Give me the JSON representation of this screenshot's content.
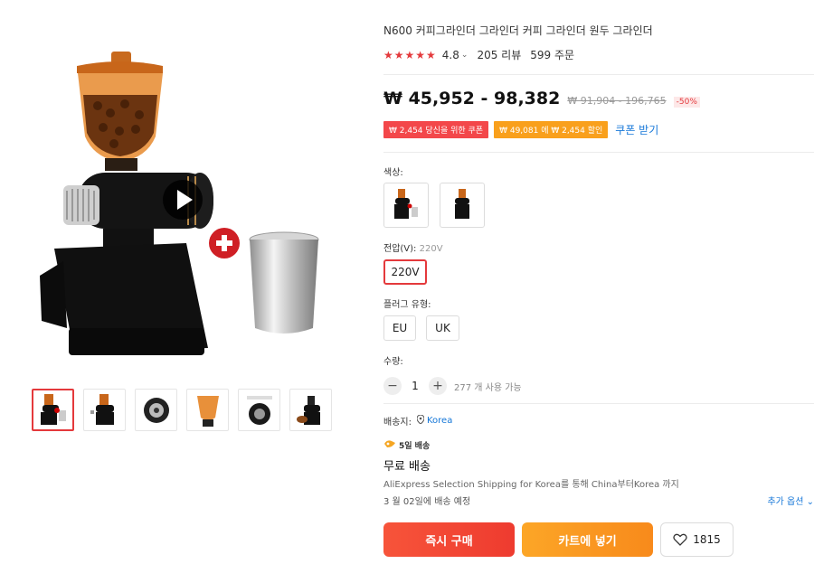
{
  "product": {
    "title": "N600 커피그라인더 그라인더 커피 그라인더 원두 그라인더",
    "rating": "4.8",
    "reviews": "205 리뷰",
    "orders": "599 주문",
    "price": "₩ 45,952 - 98,382",
    "original_price": "₩ 91,904 - 196,765",
    "discount": "-50%"
  },
  "coupons": {
    "coupon1": "₩ 2,454 당신을 위한 쿠폰",
    "coupon2": "₩ 49,081 에 ₩ 2,454 할인",
    "get_coupon": "쿠폰 받기"
  },
  "options": {
    "color_label": "색상:",
    "voltage_label": "전압(V):",
    "voltage_selected": "220V",
    "voltage_option": "220V",
    "plug_label": "플러그 유형:",
    "plug_options": [
      "EU",
      "UK"
    ]
  },
  "quantity": {
    "label": "수량:",
    "minus": "−",
    "plus": "+",
    "value": "1",
    "available": "277 개 사용 가능"
  },
  "shipping": {
    "label": "배송지:",
    "country": "Korea",
    "fast": "5일 배송",
    "free": "무료 배송",
    "desc": "AliExpress Selection Shipping for Korea를 통해 China부터Korea 까지",
    "date": "3 월 02일에 배송 예정",
    "more": "추가 옵션"
  },
  "actions": {
    "buy": "즉시 구매",
    "cart": "카트에 넣기",
    "wishlist_count": "1815"
  },
  "colors": {
    "accent": "#e4393c",
    "link": "#1677d8",
    "buy": "#f4493a",
    "cart": "#fa9a20"
  }
}
